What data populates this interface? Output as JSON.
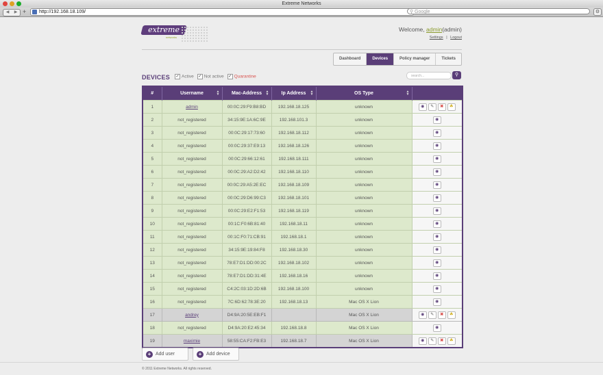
{
  "window": {
    "title": "Extreme Networks"
  },
  "browser": {
    "url": "http://192.168.18.109/",
    "search_placeholder": "Google",
    "reload_icon": "C"
  },
  "logo": {
    "text": "extreme",
    "subtext": "networks"
  },
  "user": {
    "welcome_prefix": "Welcome,",
    "username": "admin",
    "role": "(admin)",
    "settings_label": "Settings",
    "separator": "|",
    "logout_label": "Logout"
  },
  "nav": {
    "tabs": [
      {
        "label": "Dashboard",
        "active": false
      },
      {
        "label": "Devices",
        "active": true
      },
      {
        "label": "Policy manager",
        "active": false
      },
      {
        "label": "Tickets",
        "active": false
      }
    ]
  },
  "devices": {
    "heading": "DEVICES",
    "filters": [
      {
        "label": "Active",
        "checked": true
      },
      {
        "label": "Not active",
        "checked": true
      },
      {
        "label": "Quarantine",
        "checked": true
      }
    ],
    "search_placeholder": "search...",
    "columns": [
      "#",
      "Username",
      "Mac-Address",
      "Ip Address",
      "OS Type",
      ""
    ],
    "rows": [
      {
        "num": "1",
        "username": "admin",
        "mac": "00:0C:29:F9:B8:BD",
        "ip": "192.168.18.125",
        "os": "unknown",
        "link": true,
        "grey": false,
        "full_actions": true
      },
      {
        "num": "2",
        "username": "not_registered",
        "mac": "34:15:9E:1A:6C:9E",
        "ip": "192.168.101.3",
        "os": "unknown",
        "link": false,
        "grey": false,
        "full_actions": false
      },
      {
        "num": "3",
        "username": "not_registered",
        "mac": "00:0C:29:17:73:60",
        "ip": "192.168.18.112",
        "os": "unknown",
        "link": false,
        "grey": false,
        "full_actions": false
      },
      {
        "num": "4",
        "username": "not_registered",
        "mac": "00:0C:29:37:E9:13",
        "ip": "192.168.18.126",
        "os": "unknown",
        "link": false,
        "grey": false,
        "full_actions": false
      },
      {
        "num": "5",
        "username": "not_registered",
        "mac": "00:0C:29:66:12:61",
        "ip": "192.168.18.111",
        "os": "unknown",
        "link": false,
        "grey": false,
        "full_actions": false
      },
      {
        "num": "6",
        "username": "not_registered",
        "mac": "00:0C:29:A2:D2:42",
        "ip": "192.168.18.110",
        "os": "unknown",
        "link": false,
        "grey": false,
        "full_actions": false
      },
      {
        "num": "7",
        "username": "not_registered",
        "mac": "00:0C:29:A5:2E:EC",
        "ip": "192.168.18.109",
        "os": "unknown",
        "link": false,
        "grey": false,
        "full_actions": false
      },
      {
        "num": "8",
        "username": "not_registered",
        "mac": "00:0C:29:D6:99:C3",
        "ip": "192.168.18.101",
        "os": "unknown",
        "link": false,
        "grey": false,
        "full_actions": false
      },
      {
        "num": "9",
        "username": "not_registered",
        "mac": "00:0C:29:E2:F1:53",
        "ip": "192.168.18.119",
        "os": "unknown",
        "link": false,
        "grey": false,
        "full_actions": false
      },
      {
        "num": "10",
        "username": "not_registered",
        "mac": "00:1C:F0:6B:81:40",
        "ip": "192.168.18.11",
        "os": "unknown",
        "link": false,
        "grey": false,
        "full_actions": false
      },
      {
        "num": "11",
        "username": "not_registered",
        "mac": "00:1C:F0:71:CB:91",
        "ip": "192.168.18.1",
        "os": "unknown",
        "link": false,
        "grey": false,
        "full_actions": false
      },
      {
        "num": "12",
        "username": "not_registered",
        "mac": "34:15:9E:19:84:F8",
        "ip": "192.168.18.30",
        "os": "unknown",
        "link": false,
        "grey": false,
        "full_actions": false
      },
      {
        "num": "13",
        "username": "not_registered",
        "mac": "78:E7:D1:DD:00:2C",
        "ip": "192.168.18.102",
        "os": "unknown",
        "link": false,
        "grey": false,
        "full_actions": false
      },
      {
        "num": "14",
        "username": "not_registered",
        "mac": "78:E7:D1:DD:31:4E",
        "ip": "192.168.18.16",
        "os": "unknown",
        "link": false,
        "grey": false,
        "full_actions": false
      },
      {
        "num": "15",
        "username": "not_registered",
        "mac": "C4:2C:03:1D:2D:6B",
        "ip": "192.168.18.100",
        "os": "unknown",
        "link": false,
        "grey": false,
        "full_actions": false
      },
      {
        "num": "16",
        "username": "not_registered",
        "mac": "7C:6D:62:78:3E:20",
        "ip": "192.168.18.13",
        "os": "Mac OS X Lion",
        "link": false,
        "grey": false,
        "full_actions": false
      },
      {
        "num": "17",
        "username": "andrey",
        "mac": "D4:9A:20:5E:EB:F1",
        "ip": "",
        "os": "Mac OS X Lion",
        "link": true,
        "grey": true,
        "full_actions": true
      },
      {
        "num": "18",
        "username": "not_registered",
        "mac": "D4:9A:20:E2:45:34",
        "ip": "192.168.18.8",
        "os": "Mac OS X Lion",
        "link": false,
        "grey": false,
        "full_actions": false
      },
      {
        "num": "19",
        "username": "maximie",
        "mac": "58:55:CA:F2:FB:E3",
        "ip": "192.168.18.7",
        "os": "Mac OS X Lion",
        "link": true,
        "grey": true,
        "full_actions": true
      }
    ]
  },
  "buttons": {
    "add_user": "Add user",
    "add_device": "Add device"
  },
  "footer": {
    "copyright": "© 2011 Extreme Networks. All rights reserved."
  },
  "colors": {
    "brand_purple": "#5a3e78",
    "row_green": "#dde9cc",
    "row_grey": "#d4d4d4",
    "link_green": "#8a9a2c",
    "quarantine_red": "#d9534f"
  },
  "icons": {
    "view": "eye-icon",
    "edit": "pencil-icon",
    "delete": "delete-icon",
    "policy": "policy-icon",
    "search": "search-icon",
    "add": "plus-icon"
  }
}
